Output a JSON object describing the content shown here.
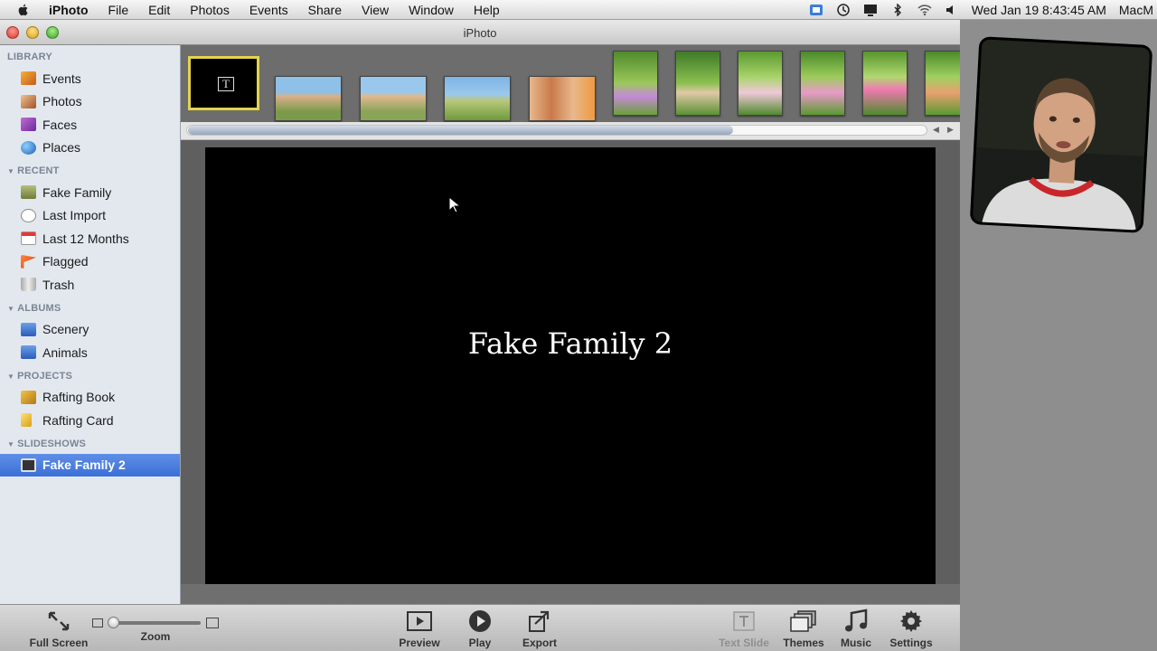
{
  "menubar": {
    "app_name": "iPhoto",
    "menus": [
      "File",
      "Edit",
      "Photos",
      "Events",
      "Share",
      "View",
      "Window",
      "Help"
    ],
    "clock": "Wed Jan 19  8:43:45 AM",
    "user": "MacM"
  },
  "window": {
    "title": "iPhoto"
  },
  "sidebar": {
    "sections": [
      {
        "label": "LIBRARY",
        "items": [
          {
            "label": "Events",
            "icon": "events-icon"
          },
          {
            "label": "Photos",
            "icon": "photos-icon"
          },
          {
            "label": "Faces",
            "icon": "faces-icon"
          },
          {
            "label": "Places",
            "icon": "globe-icon"
          }
        ]
      },
      {
        "label": "RECENT",
        "items": [
          {
            "label": "Fake Family",
            "icon": "event-icon"
          },
          {
            "label": "Last Import",
            "icon": "clock-icon"
          },
          {
            "label": "Last 12 Months",
            "icon": "calendar-icon"
          },
          {
            "label": "Flagged",
            "icon": "flag-icon"
          },
          {
            "label": "Trash",
            "icon": "trash-icon"
          }
        ]
      },
      {
        "label": "ALBUMS",
        "items": [
          {
            "label": "Scenery",
            "icon": "album-icon"
          },
          {
            "label": "Animals",
            "icon": "album-icon"
          }
        ]
      },
      {
        "label": "PROJECTS",
        "items": [
          {
            "label": "Rafting Book",
            "icon": "book-icon"
          },
          {
            "label": "Rafting Card",
            "icon": "card-icon"
          }
        ]
      },
      {
        "label": "SLIDESHOWS",
        "items": [
          {
            "label": "Fake Family 2",
            "icon": "slideshow-icon",
            "selected": true
          }
        ]
      }
    ]
  },
  "slide": {
    "title": "Fake Family 2"
  },
  "toolbar": {
    "full_screen": "Full Screen",
    "zoom": "Zoom",
    "preview": "Preview",
    "play": "Play",
    "export": "Export",
    "text_slide": "Text Slide",
    "themes": "Themes",
    "music": "Music",
    "settings": "Settings"
  },
  "colors": {
    "selection": "#3a6fd8",
    "text_thumb_border": "#e4d44a"
  }
}
